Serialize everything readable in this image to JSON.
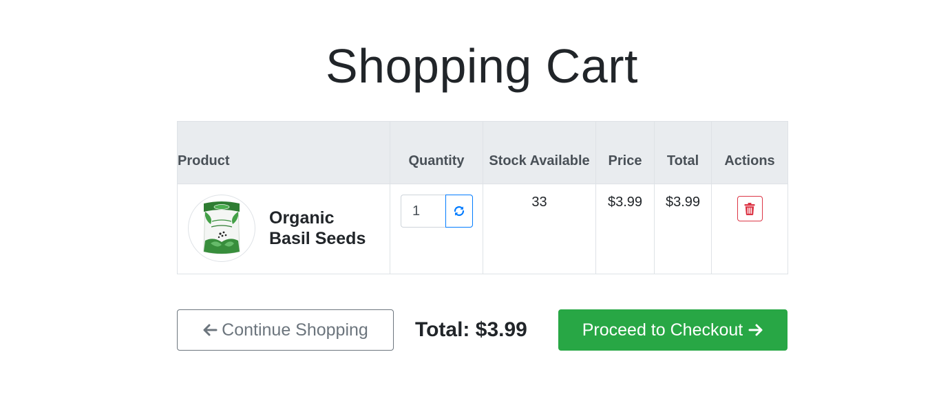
{
  "page": {
    "title": "Shopping Cart"
  },
  "cart": {
    "columns": {
      "product": "Product",
      "quantity": "Quantity",
      "stock": "Stock Available",
      "price": "Price",
      "total": "Total",
      "actions": "Actions"
    },
    "items": [
      {
        "name": "Organic Basil Seeds",
        "image_icon": "basil-seeds-package",
        "quantity": "1",
        "stock_available": "33",
        "price": "$3.99",
        "total": "$3.99",
        "refresh_icon": "refresh-icon",
        "delete_icon": "trash-icon"
      }
    ]
  },
  "footer": {
    "continue_label": "Continue Shopping",
    "continue_icon": "arrow-left-icon",
    "total_text": "Total: $3.99",
    "checkout_label": "Proceed to Checkout",
    "checkout_icon": "arrow-right-icon"
  },
  "colors": {
    "header_bg": "#e9ecef",
    "primary": "#007bff",
    "danger": "#dc3545",
    "success": "#28a745",
    "secondary": "#6c757d"
  }
}
